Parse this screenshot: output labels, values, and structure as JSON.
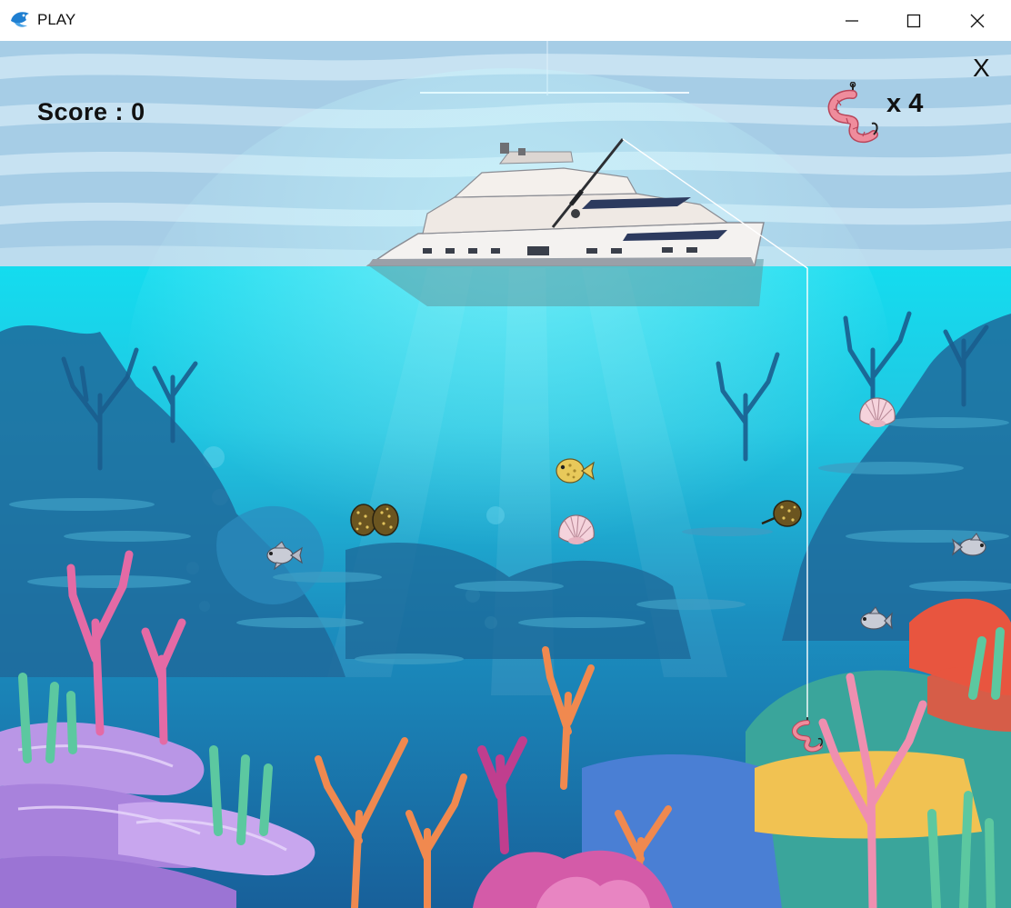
{
  "window": {
    "title": "PLAY",
    "icons": [
      "app-fish-icon",
      "minimize-icon",
      "maximize-icon",
      "close-icon"
    ]
  },
  "hud": {
    "score_label": "Score :",
    "score_value": "0",
    "bait_prefix": "x",
    "bait_count": "4",
    "close_label": "X"
  },
  "scene": {
    "colors": {
      "sky": "#a9cfe6",
      "sky_stripe": "#cfe6f3",
      "water_top": "#19d7ea",
      "water_deep": "#1a7fb0",
      "fishing_line": "#ffffff"
    },
    "objects": [
      "yacht",
      "fishing-rod",
      "worm-bait-hook",
      "fish-yellow",
      "fish-silver",
      "fish-silver",
      "fish-silver",
      "clam-shell",
      "clam-shell",
      "spotted-seed-pod",
      "spotted-seed-pod"
    ]
  }
}
